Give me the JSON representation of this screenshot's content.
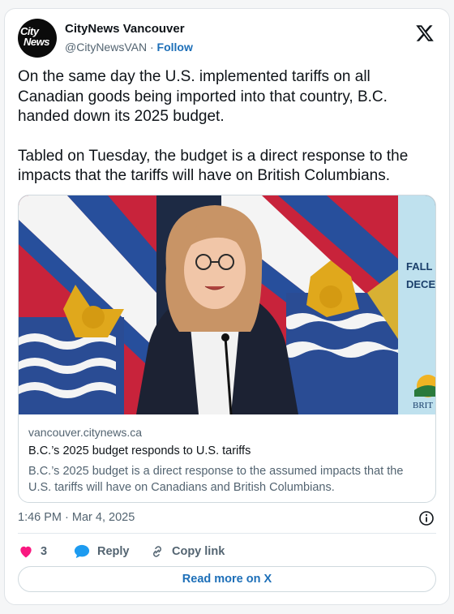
{
  "author": {
    "display_name": "CityNews Vancouver",
    "handle": "@CityNewsVAN",
    "separator": "·",
    "follow_label": "Follow",
    "avatar_line1": "City",
    "avatar_line2": "News",
    "avatar_icon": "citynews-logo"
  },
  "platform_icon": "x-logo-icon",
  "tweet": {
    "paragraph1": "On the same day the U.S. implemented tariffs on all Canadian goods being imported into that country, B.C. handed down its 2025 budget.",
    "paragraph2": "Tabled on Tuesday, the budget is a direct response to the impacts that the tariffs will have on British Columbians."
  },
  "link_card": {
    "image_sign_line1": "FALL",
    "image_sign_line2": "DECE",
    "image_sign_line3": "BRIT",
    "domain": "vancouver.citynews.ca",
    "title": "B.C.’s 2025 budget responds to U.S. tariffs",
    "description": "B.C.’s 2025 budget is a direct response to the assumed impacts that the U.S. tariffs will have on Canadians and British Columbians."
  },
  "meta": {
    "timestamp": "1:46 PM · Mar 4, 2025"
  },
  "actions": {
    "like_count": "3",
    "reply_label": "Reply",
    "copy_link_label": "Copy link"
  },
  "read_more_label": "Read more on X",
  "colors": {
    "like": "#f91880",
    "reply": "#1d9bf0",
    "link": "#1d6fb8",
    "muted": "#536471"
  }
}
